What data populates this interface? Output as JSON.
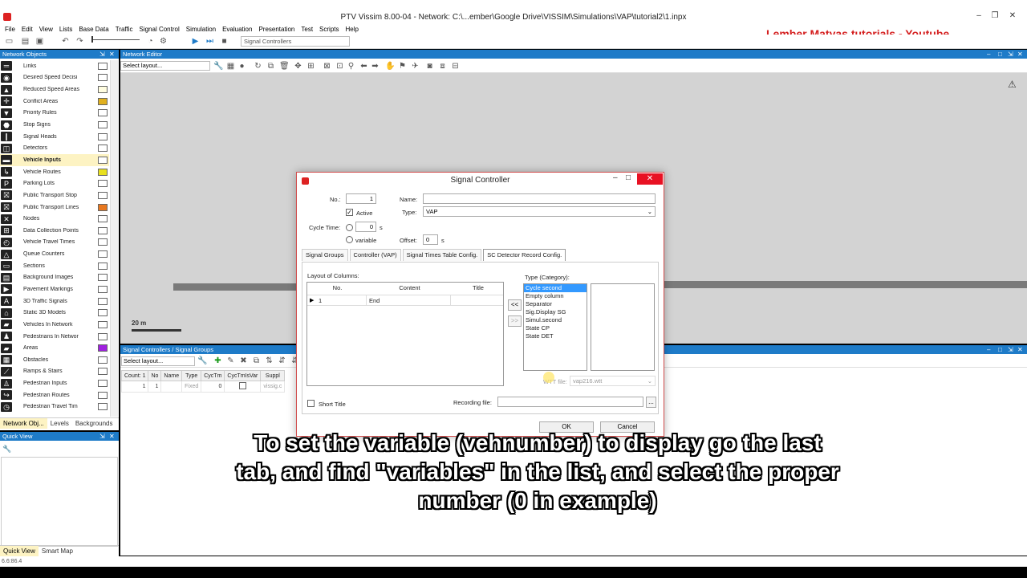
{
  "window": {
    "title": "PTV Vissim 8.00-04 - Network: C:\\...ember\\Google Drive\\VISSIM\\Simulations\\VAP\\tutorial2\\1.inpx",
    "minimize": "–",
    "maximize": "❐",
    "close": "✕"
  },
  "watermark": "Lember Matyas tutorials - Youtube",
  "menu": [
    "File",
    "Edit",
    "View",
    "Lists",
    "Base Data",
    "Traffic",
    "Signal Control",
    "Simulation",
    "Evaluation",
    "Presentation",
    "Test",
    "Scripts",
    "Help"
  ],
  "toolbar": {
    "combo_value": "Signal Controllers"
  },
  "network_objects": {
    "title": "Network Objects",
    "items": [
      {
        "label": "Links",
        "icon": "link-icon",
        "swatch": "#ffffff"
      },
      {
        "label": "Desired Speed Decisi",
        "icon": "speed-icon",
        "swatch": "#ffffff"
      },
      {
        "label": "Reduced Speed Areas",
        "icon": "triangle-warning-icon",
        "swatch": "#fffde0"
      },
      {
        "label": "Conflict Areas",
        "icon": "conflict-icon",
        "swatch": "#e0b020"
      },
      {
        "label": "Priority Rules",
        "icon": "priority-icon",
        "swatch": "#ffffff"
      },
      {
        "label": "Stop Signs",
        "icon": "stop-icon",
        "swatch": "#ffffff"
      },
      {
        "label": "Signal Heads",
        "icon": "signal-head-icon",
        "swatch": "#ffffff"
      },
      {
        "label": "Detectors",
        "icon": "detector-icon",
        "swatch": "#ffffff"
      },
      {
        "label": "Vehicle Inputs",
        "icon": "vehicle-input-icon",
        "swatch": "#ffffff",
        "selected": true
      },
      {
        "label": "Vehicle Routes",
        "icon": "route-icon",
        "swatch": "#e8e020"
      },
      {
        "label": "Parking Lots",
        "icon": "parking-icon",
        "swatch": "#ffffff"
      },
      {
        "label": "Public Transport Stop",
        "icon": "pt-stop-icon",
        "swatch": "#ffffff"
      },
      {
        "label": "Public Transport Lines",
        "icon": "pt-line-icon",
        "swatch": "#e87820"
      },
      {
        "label": "Nodes",
        "icon": "node-icon",
        "swatch": "#ffffff"
      },
      {
        "label": "Data Collection Points",
        "icon": "data-collection-icon",
        "swatch": "#ffffff"
      },
      {
        "label": "Vehicle Travel Times",
        "icon": "travel-time-icon",
        "swatch": "#ffffff"
      },
      {
        "label": "Queue Counters",
        "icon": "queue-icon",
        "swatch": "#ffffff"
      },
      {
        "label": "Sections",
        "icon": "section-icon",
        "swatch": "#ffffff"
      },
      {
        "label": "Background Images",
        "icon": "background-icon",
        "swatch": "#ffffff"
      },
      {
        "label": "Pavement Markings",
        "icon": "pavement-icon",
        "swatch": "#ffffff"
      },
      {
        "label": "3D Traffic Signals",
        "icon": "3d-signal-icon",
        "swatch": "#ffffff"
      },
      {
        "label": "Static 3D Models",
        "icon": "3d-model-icon",
        "swatch": "#ffffff"
      },
      {
        "label": "Vehicles In Network",
        "icon": "vehicle-icon",
        "swatch": "#ffffff"
      },
      {
        "label": "Pedestrians In Networ",
        "icon": "pedestrian-icon",
        "swatch": "#ffffff"
      },
      {
        "label": "Areas",
        "icon": "area-icon",
        "swatch": "#a020e0"
      },
      {
        "label": "Obstacles",
        "icon": "obstacle-icon",
        "swatch": "#ffffff"
      },
      {
        "label": "Ramps & Stairs",
        "icon": "ramp-icon",
        "swatch": "#ffffff"
      },
      {
        "label": "Pedestrian Inputs",
        "icon": "ped-input-icon",
        "swatch": "#ffffff"
      },
      {
        "label": "Pedestrian Routes",
        "icon": "ped-route-icon",
        "swatch": "#ffffff"
      },
      {
        "label": "Pedestrian Travel Tim",
        "icon": "ped-time-icon",
        "swatch": "#ffffff"
      }
    ],
    "tabs": [
      "Network Obj...",
      "Levels",
      "Backgrounds"
    ]
  },
  "quick_view": {
    "title": "Quick View",
    "tabs": [
      "Quick View",
      "Smart Map"
    ]
  },
  "network_editor": {
    "title": "Network Editor",
    "layout_placeholder": "Select layout...",
    "scale": "20 m"
  },
  "sc_panel": {
    "title": "Signal Controllers / Signal Groups",
    "layout_placeholder": "Select layout...",
    "headers": [
      "Count: 1",
      "No",
      "Name",
      "Type",
      "CycTm",
      "CycTmIsVar",
      "Suppl"
    ],
    "row": [
      "1",
      "1",
      "",
      "Fixed",
      "0",
      "",
      "vissig.c"
    ]
  },
  "status": "6.6:86.4",
  "dialog": {
    "title": "Signal Controller",
    "no_label": "No.:",
    "no_value": "1",
    "name_label": "Name:",
    "name_value": "",
    "active_label": "Active",
    "type_label": "Type:",
    "type_value": "VAP",
    "cycle_label": "Cycle Time:",
    "cycle_value": "0",
    "cycle_unit": "s",
    "variable_label": "variable",
    "offset_label": "Offset:",
    "offset_value": "0",
    "offset_unit": "s",
    "tabs": [
      "Signal Groups",
      "Controller (VAP)",
      "Signal Times Table Config.",
      "SC Detector Record Config."
    ],
    "active_tab": 3,
    "layout_label": "Layout of Columns:",
    "col_headers": [
      "No.",
      "Content",
      "Title"
    ],
    "col_row": {
      "no": "1",
      "content": "End",
      "title": ""
    },
    "type_label2": "Type (Category):",
    "type_items": [
      "Cycle second",
      "Empty column",
      "Separator",
      "Sig.Display SG",
      "Simul.second",
      "State CP",
      "State DET"
    ],
    "add_btn": "<<",
    "remove_btn": ">>",
    "wtt_label": "WTT file:",
    "wtt_value": "vap216.wtt",
    "short_title": "Short Title",
    "recording_label": "Recording file:",
    "browse": "...",
    "ok": "OK",
    "cancel": "Cancel"
  },
  "subtitle": "To set the variable (vehnumber) to display go the last tab, and find \"variables\" in the list, and select the proper number (0 in example)"
}
